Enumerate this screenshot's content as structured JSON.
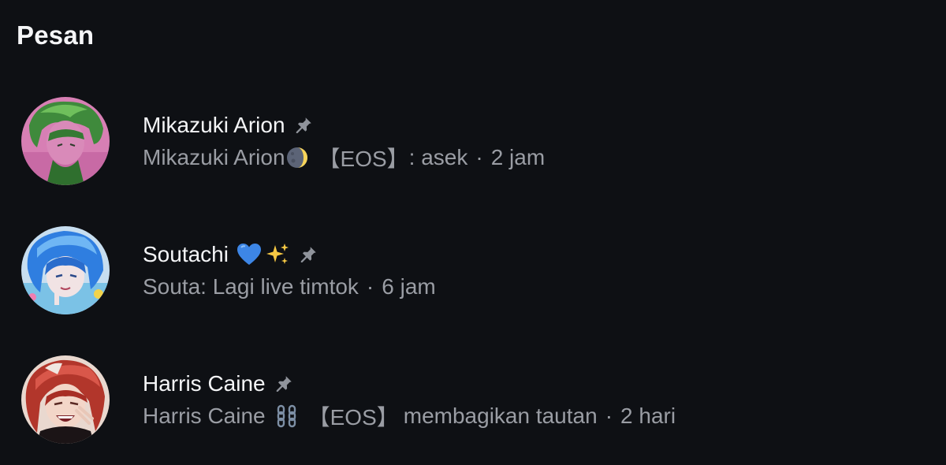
{
  "header": {
    "title": "Pesan"
  },
  "threads": [
    {
      "name": "Mikazuki Arion",
      "pinned": true,
      "preview_sender": "Mikazuki Arion",
      "preview_sender_icon": "crescent-moon-emoji",
      "preview_tag": "【EOS】",
      "preview_text": ": asek",
      "separator": "·",
      "time": "2 jam"
    },
    {
      "name": "Soutachi",
      "name_icons": [
        "blue-heart-emoji",
        "sparkles-emoji"
      ],
      "pinned": true,
      "preview_text": "Souta: Lagi live timtok",
      "separator": "·",
      "time": "6 jam"
    },
    {
      "name": "Harris Caine",
      "pinned": true,
      "preview_sender": "Harris Caine",
      "preview_sender_icon": "chain-emoji",
      "preview_tag": "【EOS】",
      "preview_text": "membagikan tautan",
      "separator": "·",
      "time": "2 hari"
    }
  ],
  "colors": {
    "background": "#0e1014",
    "primary_text": "#f4f5f7",
    "secondary_text": "#9a9da4"
  }
}
